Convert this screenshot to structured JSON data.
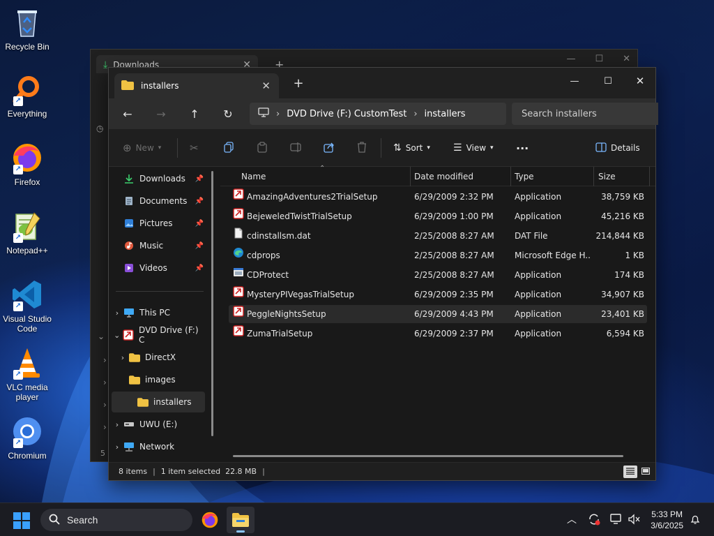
{
  "desktop": {
    "icons": [
      {
        "label": "Recycle Bin"
      },
      {
        "label": "Everything"
      },
      {
        "label": "Firefox"
      },
      {
        "label": "Notepad++"
      },
      {
        "label": "Visual Studio\nCode"
      },
      {
        "label": "VLC media\nplayer"
      },
      {
        "label": "Chromium"
      }
    ]
  },
  "back_window": {
    "tab_title": "Downloads"
  },
  "window": {
    "tab_title": "installers",
    "breadcrumb": [
      "DVD Drive (F:) CustomTest",
      "installers"
    ],
    "search_placeholder": "Search installers"
  },
  "toolbar": {
    "new_label": "New",
    "sort_label": "Sort",
    "view_label": "View",
    "details_label": "Details"
  },
  "sidebar": {
    "quick_access": [
      {
        "label": "Downloads",
        "icon": "download-icon"
      },
      {
        "label": "Documents",
        "icon": "documents-icon"
      },
      {
        "label": "Pictures",
        "icon": "pictures-icon"
      },
      {
        "label": "Music",
        "icon": "music-icon"
      },
      {
        "label": "Videos",
        "icon": "videos-icon"
      }
    ],
    "tree": [
      {
        "label": "This PC"
      },
      {
        "label": "DVD Drive (F:) C"
      },
      {
        "label": "DirectX"
      },
      {
        "label": "images"
      },
      {
        "label": "installers"
      },
      {
        "label": "UWU (E:)"
      },
      {
        "label": "Network"
      }
    ]
  },
  "columns": {
    "name": "Name",
    "date": "Date modified",
    "type": "Type",
    "size": "Size"
  },
  "files": [
    {
      "name": "AmazingAdventures2TrialSetup",
      "date": "6/29/2009 2:32 PM",
      "type": "Application",
      "size": "38,759 KB",
      "icon": "app-installer-icon"
    },
    {
      "name": "BejeweledTwistTrialSetup",
      "date": "6/29/2009 1:00 PM",
      "type": "Application",
      "size": "45,216 KB",
      "icon": "app-installer-icon"
    },
    {
      "name": "cdinstallsm.dat",
      "date": "2/25/2008 8:27 AM",
      "type": "DAT File",
      "size": "214,844 KB",
      "icon": "file-icon"
    },
    {
      "name": "cdprops",
      "date": "2/25/2008 8:27 AM",
      "type": "Microsoft Edge H...",
      "size": "1 KB",
      "icon": "edge-icon"
    },
    {
      "name": "CDProtect",
      "date": "2/25/2008 8:27 AM",
      "type": "Application",
      "size": "174 KB",
      "icon": "window-app-icon"
    },
    {
      "name": "MysteryPIVegasTrialSetup",
      "date": "6/29/2009 2:35 PM",
      "type": "Application",
      "size": "34,907 KB",
      "icon": "app-installer-icon"
    },
    {
      "name": "PeggleNightsSetup",
      "date": "6/29/2009 4:43 PM",
      "type": "Application",
      "size": "23,401 KB",
      "icon": "app-installer-icon"
    },
    {
      "name": "ZumaTrialSetup",
      "date": "6/29/2009 2:37 PM",
      "type": "Application",
      "size": "6,594 KB",
      "icon": "app-installer-icon"
    }
  ],
  "status": {
    "items": "8 items",
    "selected": "1 item selected  22.8 MB"
  },
  "taskbar": {
    "search_label": "Search",
    "time": "5:33 PM",
    "date": "3/6/2025"
  },
  "colors": {
    "accent": "#4cc2ff",
    "folder": "#f0c243",
    "selection": "#2b2b2b"
  }
}
